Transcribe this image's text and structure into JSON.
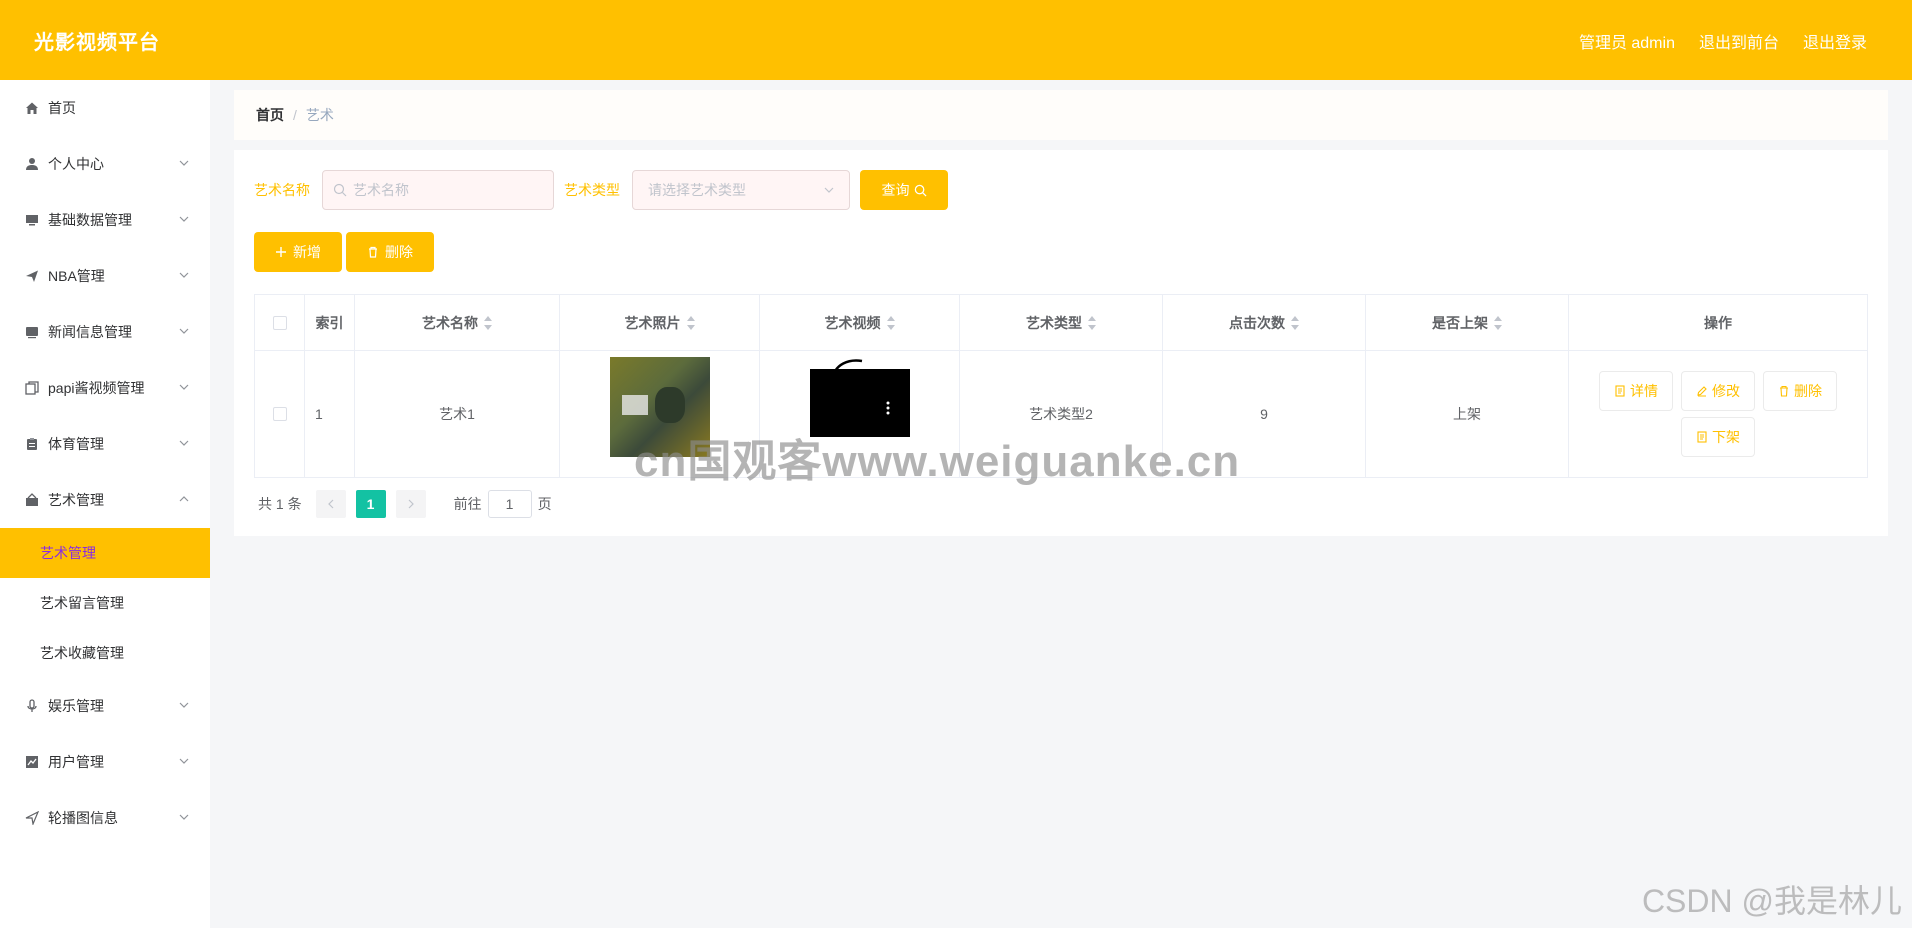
{
  "header": {
    "title": "光影视频平台",
    "user": "管理员 admin",
    "front": "退出到前台",
    "logout": "退出登录"
  },
  "sidebar": {
    "items": [
      {
        "label": "首页",
        "icon": "home-icon"
      },
      {
        "label": "个人中心",
        "icon": "user-icon"
      },
      {
        "label": "基础数据管理",
        "icon": "monitor-icon"
      },
      {
        "label": "NBA管理",
        "icon": "send-icon"
      },
      {
        "label": "新闻信息管理",
        "icon": "news-icon"
      },
      {
        "label": "papi酱视频管理",
        "icon": "copy-icon"
      },
      {
        "label": "体育管理",
        "icon": "clipboard-icon"
      },
      {
        "label": "艺术管理",
        "icon": "art-icon"
      }
    ],
    "submenu": [
      "艺术管理",
      "艺术留言管理",
      "艺术收藏管理"
    ],
    "items_after": [
      {
        "label": "娱乐管理",
        "icon": "mic-icon"
      },
      {
        "label": "用户管理",
        "icon": "chart-icon"
      },
      {
        "label": "轮播图信息",
        "icon": "navigate-icon"
      }
    ]
  },
  "breadcrumb": {
    "home": "首页",
    "sep": "/",
    "current": "艺术"
  },
  "search": {
    "name_label": "艺术名称",
    "name_placeholder": "艺术名称",
    "type_label": "艺术类型",
    "type_placeholder": "请选择艺术类型",
    "query_button": "查询"
  },
  "actions": {
    "add": "新增",
    "delete": "删除"
  },
  "table": {
    "headers": [
      "索引",
      "艺术名称",
      "艺术照片",
      "艺术视频",
      "艺术类型",
      "点击次数",
      "是否上架",
      "操作"
    ],
    "rows": [
      {
        "index": "1",
        "name": "艺术1",
        "type": "艺术类型2",
        "clicks": "9",
        "status": "上架"
      }
    ],
    "row_buttons": {
      "detail": "详情",
      "edit": "修改",
      "delete": "删除",
      "unlist": "下架"
    }
  },
  "pagination": {
    "total": "共 1 条",
    "current": "1",
    "goto": "前往",
    "page_value": "1",
    "page_unit": "页"
  },
  "watermarks": {
    "site": "cn国观客www.weiguanke.cn",
    "csdn": "CSDN @我是林儿"
  },
  "colors": {
    "primary": "#ffc000",
    "active_text": "#8a2be2",
    "page_active": "#13c2a3"
  }
}
